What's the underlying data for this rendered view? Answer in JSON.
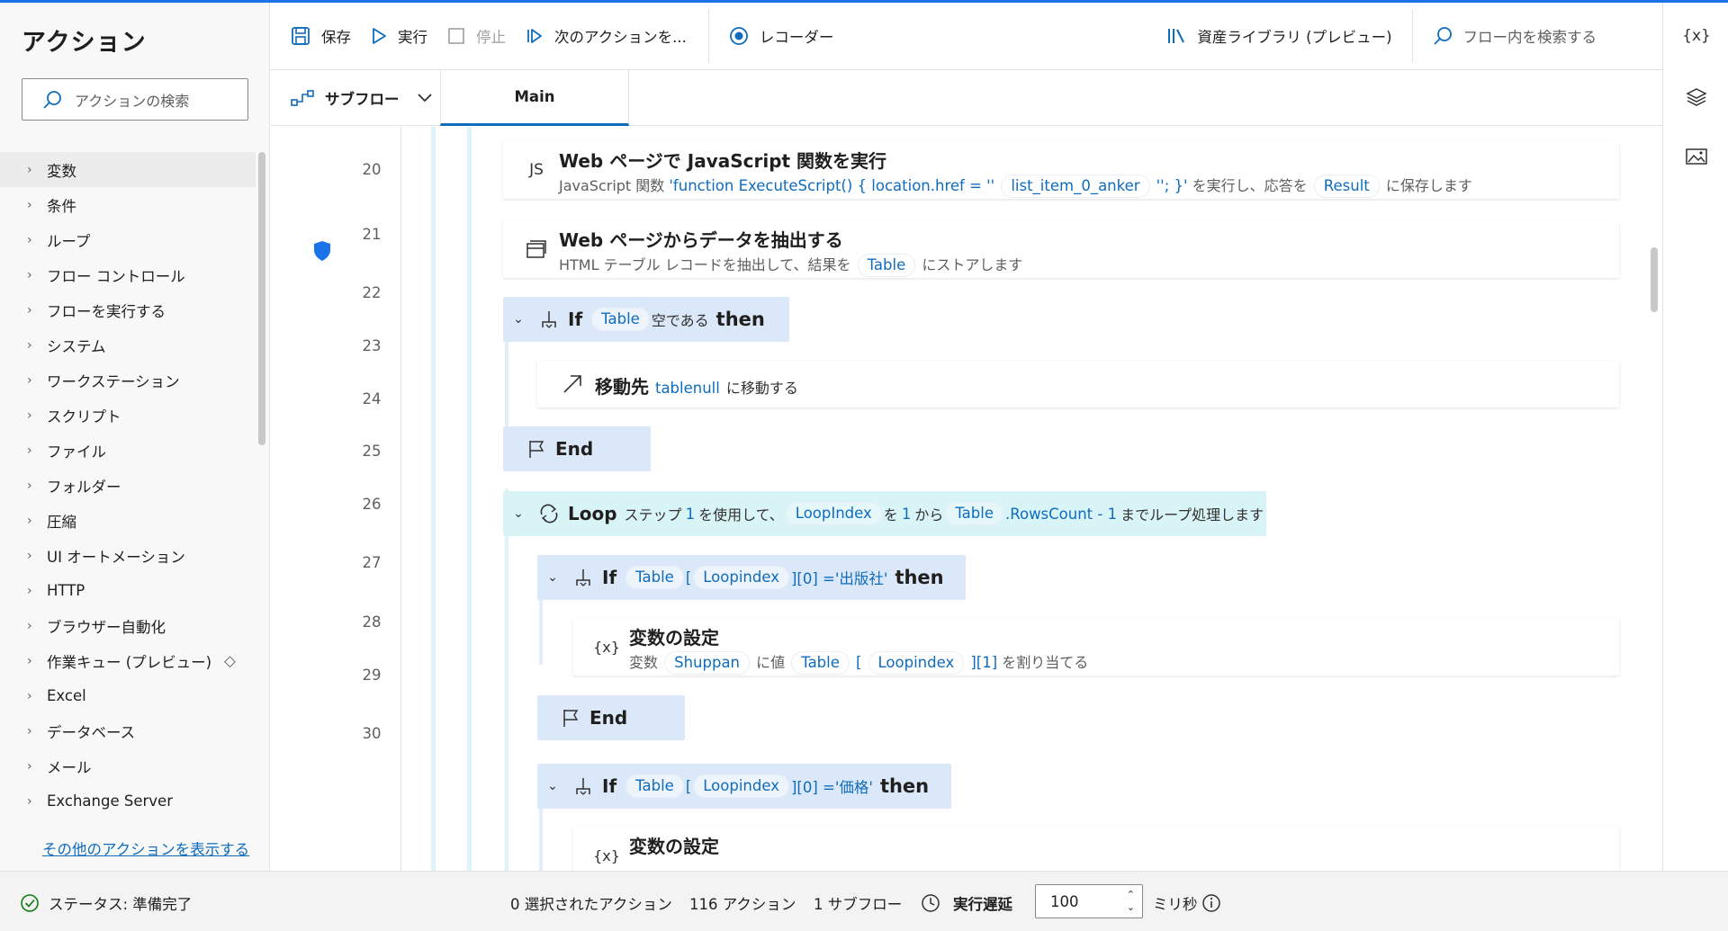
{
  "left_panel": {
    "title": "アクション",
    "search_placeholder": "アクションの検索",
    "categories": [
      "変数",
      "条件",
      "ループ",
      "フロー コントロール",
      "フローを実行する",
      "システム",
      "ワークステーション",
      "スクリプト",
      "ファイル",
      "フォルダー",
      "圧縮",
      "UI オートメーション",
      "HTTP",
      "ブラウザー自動化",
      "作業キュー (プレビュー)",
      "Excel",
      "データベース",
      "メール",
      "Exchange Server"
    ],
    "more_link": "その他のアクションを表示する"
  },
  "toolbar": {
    "save": "保存",
    "run": "実行",
    "stop": "停止",
    "next_action": "次のアクションを...",
    "recorder": "レコーダー",
    "asset_library": "資産ライブラリ (プレビュー)",
    "flow_search": "フロー内を検索する"
  },
  "tabs": {
    "subflow": "サブフロー",
    "main": "Main"
  },
  "rail": {
    "variables_icon": "{x}"
  },
  "lines": [
    "20",
    "21",
    "22",
    "23",
    "24",
    "25",
    "26",
    "27",
    "28",
    "29",
    "30"
  ],
  "steps": {
    "s20": {
      "icon": "JS",
      "title": "Web ページで JavaScript 関数を実行",
      "d1": "JavaScript 関数",
      "lit1": "'function ExecuteScript() { location.href = ''",
      "tok1": "list_item_0_anker",
      "lit2": "''; }'",
      "d2": "を実行し、応答を",
      "tok2": "Result",
      "d3": "に保存します"
    },
    "s21": {
      "title": "Web ページからデータを抽出する",
      "d1": "HTML テーブル レコードを抽出して、結果を",
      "tok1": "Table",
      "d2": "にストアします"
    },
    "s22": {
      "kw": "If",
      "tok1": "Table",
      "d1": "空である",
      "then": "then"
    },
    "s23": {
      "title": "移動先",
      "lit1": "tablenull",
      "d1": "に移動する"
    },
    "s24": {
      "title": "End"
    },
    "s25": {
      "kw": "Loop",
      "d1": "ステップ",
      "n1": "1",
      "d2": "を使用して、",
      "tok1": "LoopIndex",
      "d3": "を",
      "n2": "1",
      "d4": "から",
      "tok2": "Table",
      "lit1": ".RowsCount - 1",
      "d5": "までループ処理します"
    },
    "s26": {
      "kw": "If",
      "tok1": "Table",
      "lit0": "[",
      "tok2": "Loopindex",
      "lit1": "][0] ='出版社'",
      "then": "then"
    },
    "s27": {
      "icon": "{x}",
      "title": "変数の設定",
      "d1": "変数",
      "tok1": "Shuppan",
      "d2": "に値",
      "tok2": "Table",
      "lit0": "[",
      "tok3": "Loopindex",
      "lit1": "][1]",
      "d3": "を割り当てる"
    },
    "s28": {
      "title": "End"
    },
    "s29": {
      "kw": "If",
      "tok1": "Table",
      "lit0": "[",
      "tok2": "Loopindex",
      "lit1": "][0] ='価格'",
      "then": "then"
    },
    "s30": {
      "icon": "{x}",
      "title": "変数の設定"
    }
  },
  "status": {
    "state": "ステータス: 準備完了",
    "selected": "0 選択されたアクション",
    "actions": "116 アクション",
    "subflows": "1 サブフロー",
    "delay_label": "実行遅延",
    "delay_value": "100",
    "unit": "ミリ秒"
  },
  "colors": {
    "accent": "#0f6cbd",
    "if_block": "#dbe8fa",
    "loop_block": "#d9f4f7",
    "status_ok": "#107c10"
  }
}
